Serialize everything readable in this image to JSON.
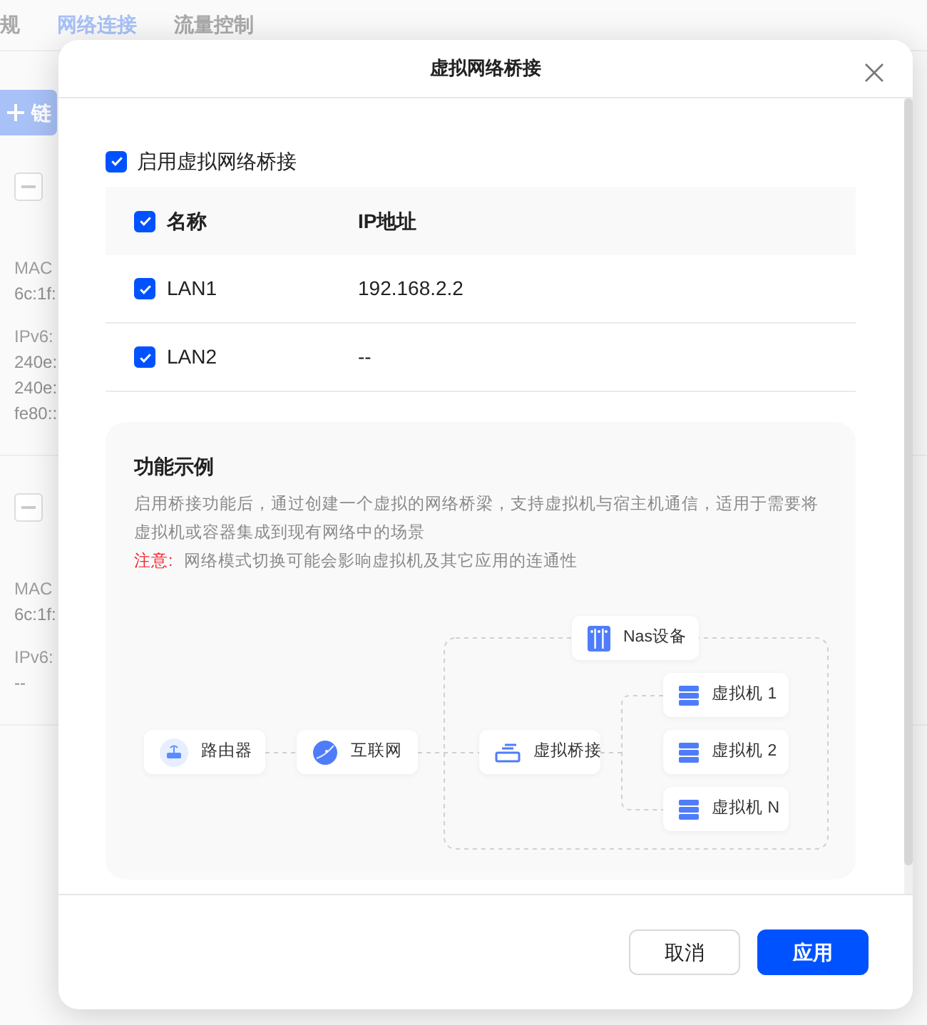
{
  "background": {
    "tabs": [
      {
        "label": "规",
        "selected": false
      },
      {
        "label": "网络连接",
        "selected": true
      },
      {
        "label": "流量控制",
        "selected": false
      }
    ],
    "add_button": "链",
    "cards": [
      {
        "lines": [
          {
            "kind": "label",
            "text": "MAC"
          },
          {
            "kind": "value",
            "text": "6c:1f:"
          },
          {
            "kind": "label",
            "text": "IPv6:"
          },
          {
            "kind": "value",
            "text": "240e:"
          },
          {
            "kind": "value",
            "text": "240e:"
          },
          {
            "kind": "value",
            "text": "fe80::"
          }
        ]
      },
      {
        "lines": [
          {
            "kind": "label",
            "text": "MAC"
          },
          {
            "kind": "value",
            "text": "6c:1f:"
          },
          {
            "kind": "label",
            "text": "IPv6:"
          },
          {
            "kind": "value",
            "text": "--"
          }
        ]
      }
    ]
  },
  "dialog": {
    "title": "虚拟网络桥接",
    "enable": {
      "label": "启用虚拟网络桥接",
      "checked": true
    },
    "table": {
      "columns": [
        "名称",
        "IP地址"
      ],
      "header_checked": true,
      "rows": [
        {
          "name": "LAN1",
          "ip": "192.168.2.2",
          "checked": true
        },
        {
          "name": "LAN2",
          "ip": "--",
          "checked": true
        }
      ]
    },
    "example": {
      "title": "功能示例",
      "description": "启用桥接功能后，通过创建一个虚拟的网络桥梁，支持虚拟机与宿主机通信，适用于需要将虚拟机或容器集成到现有网络中的场景",
      "note_label": "注意:",
      "note": "网络模式切换可能会影响虚拟机及其它应用的连通性",
      "nodes": [
        {
          "kind": "router",
          "label": "路由器"
        },
        {
          "kind": "internet",
          "label": "互联网"
        },
        {
          "kind": "bridge",
          "label": "虚拟桥接"
        },
        {
          "kind": "nas",
          "label": "Nas设备"
        },
        {
          "kind": "vm",
          "label": "虚拟机 1"
        },
        {
          "kind": "vm",
          "label": "虚拟机 2"
        },
        {
          "kind": "vm",
          "label": "虚拟机 N"
        }
      ]
    },
    "buttons": [
      {
        "kind": "secondary",
        "label": "取消"
      },
      {
        "kind": "primary",
        "label": "应用"
      }
    ]
  }
}
